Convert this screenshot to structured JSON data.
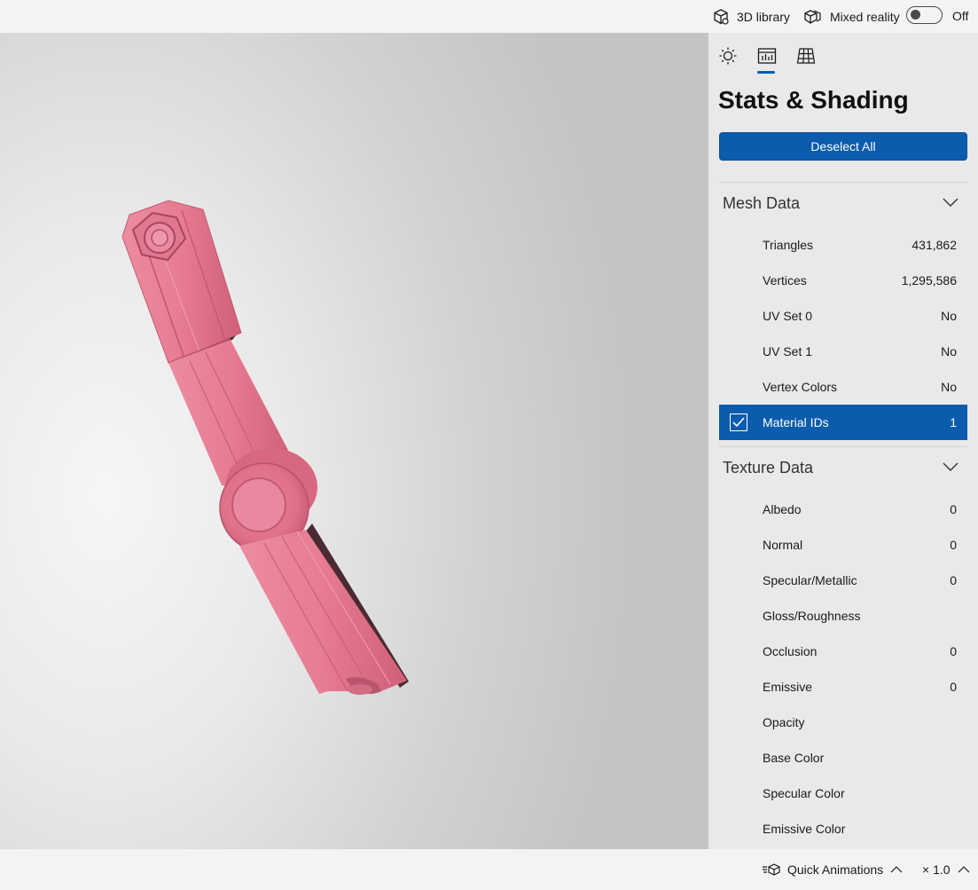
{
  "topbar": {
    "library_label": "3D library",
    "library_icon": "cube-icon",
    "mixed_reality_label": "Mixed reality",
    "mixed_reality_icon": "mixed-reality-icon",
    "toggle_state": "Off"
  },
  "viewport": {
    "model_color": "#e8778e",
    "model_icon": "3d-model"
  },
  "panel": {
    "tabs": [
      {
        "name": "lighting",
        "icon": "sun-icon"
      },
      {
        "name": "stats",
        "icon": "stats-icon",
        "active": true
      },
      {
        "name": "grid",
        "icon": "grid-icon"
      }
    ],
    "title": "Stats & Shading",
    "deselect_label": "Deselect All",
    "mesh": {
      "title": "Mesh Data",
      "rows": [
        {
          "label": "Triangles",
          "value": "431,862"
        },
        {
          "label": "Vertices",
          "value": "1,295,586"
        },
        {
          "label": "UV Set 0",
          "value": "No"
        },
        {
          "label": "UV Set 1",
          "value": "No"
        },
        {
          "label": "Vertex Colors",
          "value": "No"
        },
        {
          "label": "Material IDs",
          "value": "1",
          "selected": true
        }
      ]
    },
    "texture": {
      "title": "Texture Data",
      "rows": [
        {
          "label": "Albedo",
          "value": "0"
        },
        {
          "label": "Normal",
          "value": "0"
        },
        {
          "label": "Specular/Metallic",
          "value": "0"
        },
        {
          "label": "Gloss/Roughness",
          "value": ""
        },
        {
          "label": "Occlusion",
          "value": "0"
        },
        {
          "label": "Emissive",
          "value": "0"
        },
        {
          "label": "Opacity",
          "value": ""
        },
        {
          "label": "Base Color",
          "value": ""
        },
        {
          "label": "Specular Color",
          "value": ""
        },
        {
          "label": "Emissive Color",
          "value": ""
        }
      ]
    },
    "accent_color": "#0b5cad"
  },
  "bottombar": {
    "animations_label": "Quick Animations",
    "animations_icon": "animation-icon",
    "speed_label": "× 1.0"
  }
}
